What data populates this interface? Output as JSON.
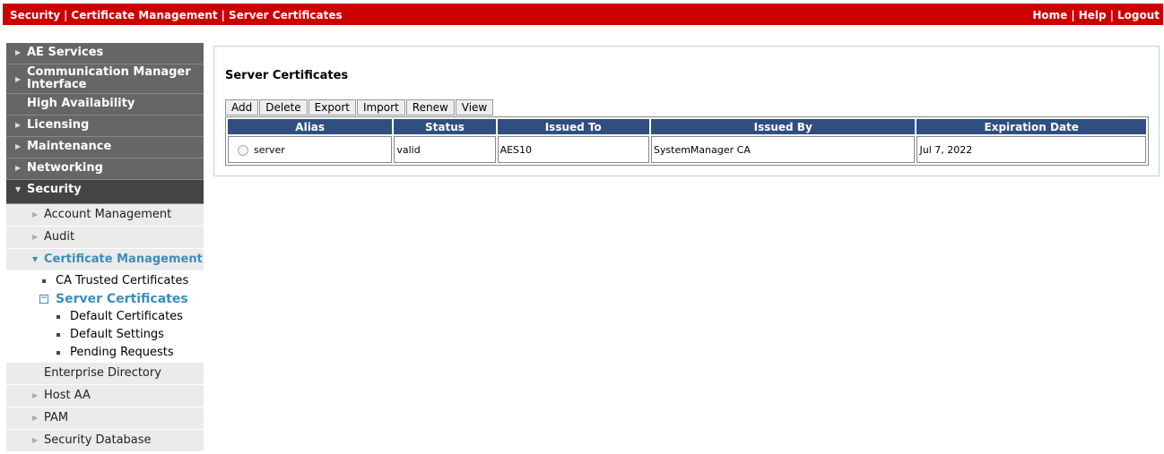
{
  "breadcrumb": [
    "Security",
    "Certificate Management",
    "Server Certificates"
  ],
  "top_links": [
    "Home",
    "Help",
    "Logout"
  ],
  "sidebar": {
    "top": [
      {
        "label": "AE Services"
      },
      {
        "label": "Communication Manager Interface"
      },
      {
        "label": "High Availability"
      },
      {
        "label": "Licensing"
      },
      {
        "label": "Maintenance"
      },
      {
        "label": "Networking"
      },
      {
        "label": "Security"
      }
    ],
    "security_items": {
      "account_management": "Account Management",
      "audit": "Audit",
      "certificate_management": "Certificate Management",
      "ca_trusted": "CA Trusted Certificates",
      "server_certificates": "Server Certificates",
      "default_certificates": "Default Certificates",
      "default_settings": "Default Settings",
      "pending_requests": "Pending Requests",
      "enterprise_directory": "Enterprise Directory",
      "host_aa": "Host AA",
      "pam": "PAM",
      "security_database": "Security Database"
    }
  },
  "main": {
    "title": "Server Certificates",
    "buttons": [
      "Add",
      "Delete",
      "Export",
      "Import",
      "Renew",
      "View"
    ],
    "table": {
      "headers": [
        "Alias",
        "Status",
        "Issued To",
        "Issued By",
        "Expiration Date"
      ],
      "rows": [
        {
          "alias": "server",
          "status": "valid",
          "issued_to": "AES10",
          "issued_by": "SystemManager CA",
          "expiration": "Jul 7, 2022"
        }
      ]
    }
  },
  "colors": {
    "topbar": "#cc0000",
    "nav_dark": "#666666",
    "nav_active": "#444444",
    "accent": "#3c8dbc",
    "table_header": "#2f4f80"
  }
}
